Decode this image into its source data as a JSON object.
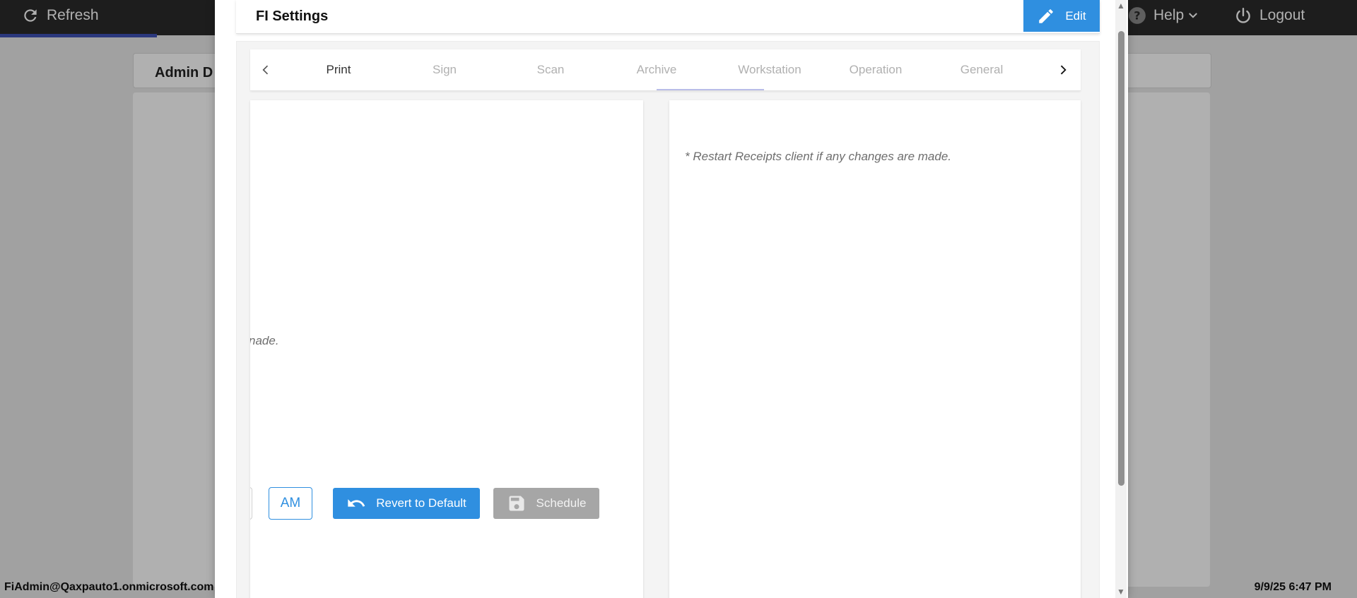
{
  "topbar": {
    "refresh_label": "Refresh",
    "help_label": "Help",
    "logout_label": "Logout"
  },
  "background": {
    "card_title": "Admin D"
  },
  "footer": {
    "user": "FiAdmin@Qaxpauto1.onmicrosoft.com",
    "datetime": "9/9/25 6:47 PM"
  },
  "modal": {
    "title": "FI Settings",
    "edit_label": "Edit",
    "tabs": [
      {
        "label": "Print",
        "active": true
      },
      {
        "label": "Sign",
        "active": false
      },
      {
        "label": "Scan",
        "active": false
      },
      {
        "label": "Archive",
        "active": false
      },
      {
        "label": "Workstation",
        "active": false
      },
      {
        "label": "Operation",
        "active": false
      },
      {
        "label": "General",
        "active": false
      }
    ],
    "left_panel": {
      "note_fragment": "nade.",
      "am_label": "AM",
      "revert_label": "Revert to Default",
      "schedule_label": "Schedule"
    },
    "right_panel": {
      "note": "* Restart Receipts client if any changes are made."
    }
  },
  "colors": {
    "accent": "#2f8fe0",
    "topbar": "#2b2b2b",
    "disabled_button": "#a6a6a6"
  }
}
